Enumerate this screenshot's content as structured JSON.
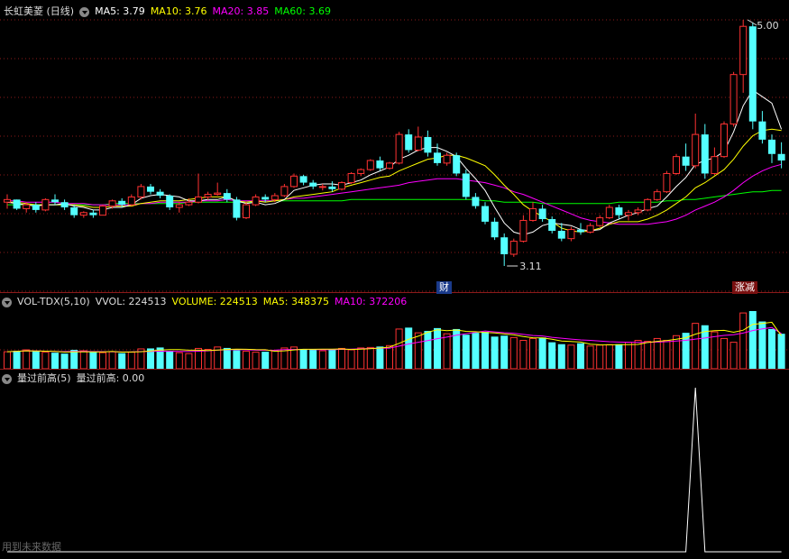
{
  "header": {
    "title": "长虹美菱 (日线)",
    "ma5": "MA5: 3.79",
    "ma10": "MA10: 3.76",
    "ma20": "MA20: 3.85",
    "ma60": "MA60: 3.69"
  },
  "vol_header": {
    "label": "VOL-TDX(5,10)",
    "vvol": "VVOL: 224513",
    "volume": "VOLUME: 224513",
    "ma5": "MA5: 348375",
    "ma10": "MA10: 372206"
  },
  "ind_header": {
    "name": "量过前高(5)",
    "value": "量过前高: 0.00"
  },
  "annotations": {
    "high": "5.00",
    "low": "3.11",
    "tag_cai": "财",
    "tag_zhangjian": "涨减"
  },
  "footer_note": "用到未来数据",
  "colors": {
    "up": "#ff3232",
    "down": "#54ffff",
    "ma5": "#ffffff",
    "ma10": "#ffff00",
    "ma20": "#ff00ff",
    "ma60": "#00ff00",
    "bg": "#000000",
    "grid": "#8b1a1a"
  },
  "chart_data": [
    {
      "type": "candlestick",
      "title": "长虹美菱 (日线)",
      "ylim": [
        3.0,
        5.1
      ],
      "candles": [
        [
          3.6,
          3.66,
          3.55,
          3.62
        ],
        [
          3.62,
          3.62,
          3.54,
          3.55
        ],
        [
          3.55,
          3.6,
          3.52,
          3.58
        ],
        [
          3.58,
          3.6,
          3.52,
          3.54
        ],
        [
          3.54,
          3.63,
          3.53,
          3.62
        ],
        [
          3.62,
          3.66,
          3.58,
          3.6
        ],
        [
          3.6,
          3.62,
          3.54,
          3.56
        ],
        [
          3.56,
          3.58,
          3.48,
          3.5
        ],
        [
          3.5,
          3.53,
          3.48,
          3.52
        ],
        [
          3.52,
          3.54,
          3.48,
          3.5
        ],
        [
          3.5,
          3.58,
          3.5,
          3.57
        ],
        [
          3.57,
          3.62,
          3.55,
          3.61
        ],
        [
          3.61,
          3.63,
          3.56,
          3.58
        ],
        [
          3.58,
          3.66,
          3.57,
          3.64
        ],
        [
          3.64,
          3.74,
          3.62,
          3.72
        ],
        [
          3.72,
          3.74,
          3.66,
          3.68
        ],
        [
          3.68,
          3.7,
          3.63,
          3.65
        ],
        [
          3.65,
          3.66,
          3.54,
          3.56
        ],
        [
          3.56,
          3.6,
          3.52,
          3.58
        ],
        [
          3.58,
          3.63,
          3.57,
          3.6
        ],
        [
          3.6,
          3.82,
          3.59,
          3.64
        ],
        [
          3.64,
          3.68,
          3.62,
          3.66
        ],
        [
          3.66,
          3.75,
          3.65,
          3.67
        ],
        [
          3.67,
          3.7,
          3.6,
          3.62
        ],
        [
          3.62,
          3.64,
          3.46,
          3.48
        ],
        [
          3.48,
          3.6,
          3.47,
          3.58
        ],
        [
          3.58,
          3.66,
          3.57,
          3.64
        ],
        [
          3.64,
          3.66,
          3.6,
          3.62
        ],
        [
          3.62,
          3.67,
          3.6,
          3.65
        ],
        [
          3.65,
          3.74,
          3.64,
          3.72
        ],
        [
          3.72,
          3.82,
          3.71,
          3.8
        ],
        [
          3.8,
          3.81,
          3.73,
          3.75
        ],
        [
          3.75,
          3.77,
          3.7,
          3.72
        ],
        [
          3.72,
          3.74,
          3.69,
          3.72
        ],
        [
          3.72,
          3.76,
          3.68,
          3.7
        ],
        [
          3.7,
          3.76,
          3.69,
          3.75
        ],
        [
          3.75,
          3.83,
          3.74,
          3.82
        ],
        [
          3.82,
          3.86,
          3.8,
          3.85
        ],
        [
          3.85,
          3.93,
          3.84,
          3.92
        ],
        [
          3.92,
          3.95,
          3.84,
          3.86
        ],
        [
          3.86,
          3.91,
          3.85,
          3.9
        ],
        [
          3.9,
          4.14,
          3.89,
          4.12
        ],
        [
          4.12,
          4.16,
          3.98,
          4.0
        ],
        [
          4.0,
          4.18,
          3.99,
          4.1
        ],
        [
          4.1,
          4.15,
          3.95,
          3.98
        ],
        [
          3.98,
          4.05,
          3.88,
          3.9
        ],
        [
          3.9,
          3.98,
          3.88,
          3.96
        ],
        [
          3.96,
          3.98,
          3.8,
          3.82
        ],
        [
          3.82,
          3.85,
          3.62,
          3.64
        ],
        [
          3.64,
          3.67,
          3.55,
          3.57
        ],
        [
          3.57,
          3.6,
          3.43,
          3.45
        ],
        [
          3.45,
          3.48,
          3.31,
          3.33
        ],
        [
          3.33,
          3.36,
          3.11,
          3.2
        ],
        [
          3.2,
          3.32,
          3.18,
          3.3
        ],
        [
          3.3,
          3.5,
          3.29,
          3.46
        ],
        [
          3.46,
          3.6,
          3.45,
          3.55
        ],
        [
          3.55,
          3.58,
          3.45,
          3.47
        ],
        [
          3.47,
          3.49,
          3.36,
          3.38
        ],
        [
          3.38,
          3.44,
          3.3,
          3.32
        ],
        [
          3.32,
          3.41,
          3.3,
          3.39
        ],
        [
          3.39,
          3.44,
          3.35,
          3.37
        ],
        [
          3.37,
          3.44,
          3.36,
          3.42
        ],
        [
          3.42,
          3.5,
          3.41,
          3.48
        ],
        [
          3.48,
          3.58,
          3.47,
          3.56
        ],
        [
          3.56,
          3.58,
          3.47,
          3.5
        ],
        [
          3.5,
          3.54,
          3.46,
          3.52
        ],
        [
          3.52,
          3.56,
          3.5,
          3.54
        ],
        [
          3.54,
          3.63,
          3.53,
          3.62
        ],
        [
          3.62,
          3.7,
          3.61,
          3.68
        ],
        [
          3.68,
          3.84,
          3.67,
          3.82
        ],
        [
          3.82,
          3.97,
          3.81,
          3.95
        ],
        [
          3.95,
          4.05,
          3.84,
          3.88
        ],
        [
          3.88,
          4.28,
          3.86,
          4.12
        ],
        [
          4.12,
          4.2,
          3.78,
          3.82
        ],
        [
          3.82,
          4.02,
          3.81,
          3.95
        ],
        [
          3.95,
          4.22,
          3.94,
          4.2
        ],
        [
          4.2,
          4.6,
          4.18,
          4.58
        ],
        [
          4.58,
          5.0,
          4.44,
          4.95
        ],
        [
          4.95,
          4.98,
          4.16,
          4.22
        ],
        [
          4.22,
          4.3,
          4.05,
          4.08
        ],
        [
          4.08,
          4.12,
          3.9,
          3.97
        ],
        [
          3.97,
          4.06,
          3.86,
          3.92
        ]
      ],
      "ma5": [
        3.6,
        3.59,
        3.58,
        3.57,
        3.58,
        3.58,
        3.59,
        3.57,
        3.56,
        3.54,
        3.54,
        3.56,
        3.56,
        3.58,
        3.63,
        3.65,
        3.66,
        3.65,
        3.64,
        3.61,
        3.61,
        3.62,
        3.62,
        3.64,
        3.61,
        3.59,
        3.6,
        3.58,
        3.59,
        3.62,
        3.69,
        3.71,
        3.73,
        3.74,
        3.74,
        3.73,
        3.75,
        3.77,
        3.81,
        3.84,
        3.87,
        3.93,
        3.96,
        4.0,
        4.02,
        4.02,
        3.99,
        3.95,
        3.86,
        3.78,
        3.69,
        3.56,
        3.44,
        3.37,
        3.35,
        3.37,
        3.42,
        3.44,
        3.43,
        3.42,
        3.39,
        3.38,
        3.39,
        3.44,
        3.47,
        3.5,
        3.52,
        3.55,
        3.57,
        3.64,
        3.72,
        3.79,
        3.89,
        3.92,
        3.94,
        3.99,
        4.14,
        4.34,
        4.46,
        4.41,
        4.36,
        4.16
      ],
      "ma10": [
        3.6,
        3.6,
        3.59,
        3.58,
        3.58,
        3.58,
        3.58,
        3.58,
        3.57,
        3.56,
        3.56,
        3.57,
        3.57,
        3.57,
        3.59,
        3.6,
        3.61,
        3.61,
        3.61,
        3.62,
        3.63,
        3.64,
        3.64,
        3.64,
        3.61,
        3.6,
        3.61,
        3.6,
        3.61,
        3.62,
        3.64,
        3.65,
        3.66,
        3.67,
        3.68,
        3.71,
        3.73,
        3.75,
        3.77,
        3.79,
        3.8,
        3.84,
        3.87,
        3.9,
        3.93,
        3.94,
        3.96,
        3.96,
        3.94,
        3.91,
        3.88,
        3.81,
        3.73,
        3.66,
        3.58,
        3.53,
        3.49,
        3.45,
        3.4,
        3.38,
        3.37,
        3.38,
        3.4,
        3.43,
        3.45,
        3.45,
        3.45,
        3.47,
        3.5,
        3.54,
        3.59,
        3.64,
        3.71,
        3.75,
        3.8,
        3.85,
        3.93,
        4.03,
        4.11,
        4.15,
        4.16,
        4.15
      ],
      "ma20": [
        3.61,
        3.61,
        3.6,
        3.6,
        3.6,
        3.6,
        3.59,
        3.59,
        3.59,
        3.58,
        3.58,
        3.58,
        3.58,
        3.58,
        3.59,
        3.59,
        3.6,
        3.6,
        3.6,
        3.6,
        3.61,
        3.61,
        3.61,
        3.62,
        3.61,
        3.61,
        3.61,
        3.61,
        3.61,
        3.62,
        3.63,
        3.63,
        3.64,
        3.65,
        3.66,
        3.67,
        3.68,
        3.69,
        3.7,
        3.71,
        3.72,
        3.73,
        3.75,
        3.76,
        3.77,
        3.78,
        3.78,
        3.78,
        3.77,
        3.76,
        3.75,
        3.73,
        3.71,
        3.68,
        3.66,
        3.63,
        3.6,
        3.57,
        3.54,
        3.51,
        3.48,
        3.46,
        3.45,
        3.44,
        3.43,
        3.43,
        3.43,
        3.43,
        3.44,
        3.45,
        3.47,
        3.5,
        3.54,
        3.57,
        3.6,
        3.64,
        3.69,
        3.75,
        3.8,
        3.84,
        3.87,
        3.89
      ],
      "ma60": [
        3.58,
        3.58,
        3.58,
        3.58,
        3.58,
        3.58,
        3.58,
        3.58,
        3.58,
        3.58,
        3.58,
        3.59,
        3.59,
        3.59,
        3.59,
        3.59,
        3.59,
        3.59,
        3.59,
        3.6,
        3.6,
        3.6,
        3.6,
        3.6,
        3.6,
        3.6,
        3.6,
        3.61,
        3.61,
        3.61,
        3.61,
        3.61,
        3.61,
        3.61,
        3.61,
        3.61,
        3.62,
        3.62,
        3.62,
        3.62,
        3.62,
        3.62,
        3.62,
        3.62,
        3.62,
        3.62,
        3.62,
        3.62,
        3.62,
        3.62,
        3.61,
        3.61,
        3.6,
        3.6,
        3.6,
        3.6,
        3.59,
        3.59,
        3.59,
        3.59,
        3.59,
        3.59,
        3.59,
        3.59,
        3.6,
        3.6,
        3.6,
        3.6,
        3.6,
        3.61,
        3.61,
        3.62,
        3.62,
        3.63,
        3.64,
        3.65,
        3.66,
        3.67,
        3.68,
        3.68,
        3.69,
        3.69
      ]
    },
    {
      "type": "bar",
      "title": "VOL-TDX(5,10)",
      "volumes": [
        180000,
        190000,
        200000,
        185000,
        175000,
        170000,
        160000,
        200000,
        190000,
        175000,
        170000,
        180000,
        165000,
        175000,
        210000,
        215000,
        225000,
        190000,
        170000,
        160000,
        215000,
        205000,
        230000,
        220000,
        195000,
        185000,
        175000,
        180000,
        190000,
        220000,
        230000,
        210000,
        200000,
        190000,
        205000,
        215000,
        200000,
        220000,
        225000,
        235000,
        245000,
        420000,
        435000,
        380000,
        400000,
        430000,
        370000,
        420000,
        360000,
        380000,
        390000,
        340000,
        350000,
        330000,
        300000,
        320000,
        330000,
        280000,
        260000,
        250000,
        270000,
        240000,
        250000,
        255000,
        260000,
        280000,
        300000,
        290000,
        320000,
        300000,
        350000,
        380000,
        480000,
        460000,
        390000,
        320000,
        280000,
        590000,
        610000,
        500000,
        420000,
        370000
      ],
      "vol_ma5": [
        180000,
        185000,
        190000,
        189000,
        186000,
        184000,
        176000,
        178000,
        179000,
        179000,
        177000,
        183000,
        176000,
        177000,
        180000,
        189000,
        198000,
        203000,
        202000,
        196000,
        196000,
        193000,
        198000,
        204000,
        207000,
        206000,
        202000,
        201000,
        185000,
        190000,
        199000,
        206000,
        206000,
        208000,
        207000,
        210000,
        204000,
        208000,
        213000,
        219000,
        229000,
        269000,
        312000,
        344000,
        386000,
        413000,
        403000,
        410000,
        396000,
        392000,
        384000,
        378000,
        368000,
        358000,
        340000,
        328000,
        326000,
        312000,
        294000,
        288000,
        282000,
        260000,
        254000,
        253000,
        255000,
        255000,
        257000,
        277000,
        290000,
        298000,
        312000,
        328000,
        366000,
        394000,
        402000,
        406000,
        386000,
        408000,
        470000,
        478000,
        492000,
        348375
      ],
      "vol_ma10": [
        180000,
        185000,
        190000,
        189000,
        186000,
        184000,
        181000,
        183000,
        183000,
        182000,
        181000,
        180000,
        177000,
        178000,
        182000,
        183000,
        186000,
        185000,
        183000,
        182000,
        186000,
        190000,
        196000,
        201000,
        203000,
        200000,
        196000,
        195000,
        196000,
        203000,
        204000,
        205000,
        204000,
        201000,
        202000,
        205000,
        207000,
        211000,
        214000,
        218000,
        218000,
        239000,
        262000,
        280000,
        297000,
        318000,
        335000,
        355000,
        371000,
        385000,
        399000,
        390000,
        381000,
        376000,
        363000,
        352000,
        347000,
        333000,
        323000,
        314000,
        305000,
        300000,
        293000,
        286000,
        282000,
        280000,
        278000,
        279000,
        282000,
        286000,
        293000,
        300000,
        314000,
        325000,
        339000,
        353000,
        360000,
        377000,
        404000,
        422000,
        436000,
        372206
      ]
    },
    {
      "type": "line",
      "title": "量过前高(5)",
      "ylim": [
        0,
        1
      ],
      "values": [
        0,
        0,
        0,
        0,
        0,
        0,
        0,
        0,
        0,
        0,
        0,
        0,
        0,
        0,
        0,
        0,
        0,
        0,
        0,
        0,
        0,
        0,
        0,
        0,
        0,
        0,
        0,
        0,
        0,
        0,
        0,
        0,
        0,
        0,
        0,
        0,
        0,
        0,
        0,
        0,
        0,
        0,
        0,
        0,
        0,
        0,
        0,
        0,
        0,
        0,
        0,
        0,
        0,
        0,
        0,
        0,
        0,
        0,
        0,
        0,
        0,
        0,
        0,
        0,
        0,
        0,
        0,
        0,
        0,
        0,
        0,
        0,
        1,
        0,
        0,
        0,
        0,
        0,
        0,
        0,
        0,
        0
      ]
    }
  ]
}
